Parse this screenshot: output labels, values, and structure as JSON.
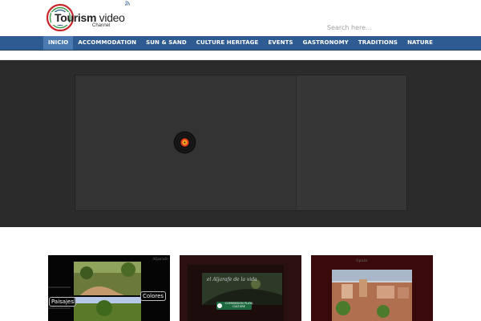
{
  "header": {
    "logo_main_bold": "Tourism",
    "logo_main_light": " video",
    "logo_sub": "Channel",
    "rss_icon": "rss-icon",
    "search_placeholder": "Search here..."
  },
  "nav": {
    "items": [
      {
        "label": "INICIO",
        "active": true
      },
      {
        "label": "ACCOMMODATION"
      },
      {
        "label": "SUN & SAND"
      },
      {
        "label": "CULTURE HERITAGE"
      },
      {
        "label": "EVENTS"
      },
      {
        "label": "GASTRONOMY"
      },
      {
        "label": "TRADITIONS"
      },
      {
        "label": "NATURE"
      }
    ]
  },
  "slider": {
    "loader_icon": "vinyl-record-icon"
  },
  "thumbnails": [
    {
      "captions": [
        "Paisajes",
        "Colores"
      ],
      "brand": "Aljarafe"
    },
    {
      "overlay_title": "el Aljarafe de la vida",
      "badge_line1": "COMMISSION PLAYA",
      "badge_line2": "CULTURE"
    },
    {
      "brand": "Spain"
    }
  ],
  "colors": {
    "nav_bg": "#2e5c92",
    "nav_active": "#4a7ab0",
    "slider_bg": "#2b2b2b",
    "logo_red": "#c8262c",
    "logo_green": "#3a9a4a",
    "logo_blue": "#2e5c92"
  }
}
